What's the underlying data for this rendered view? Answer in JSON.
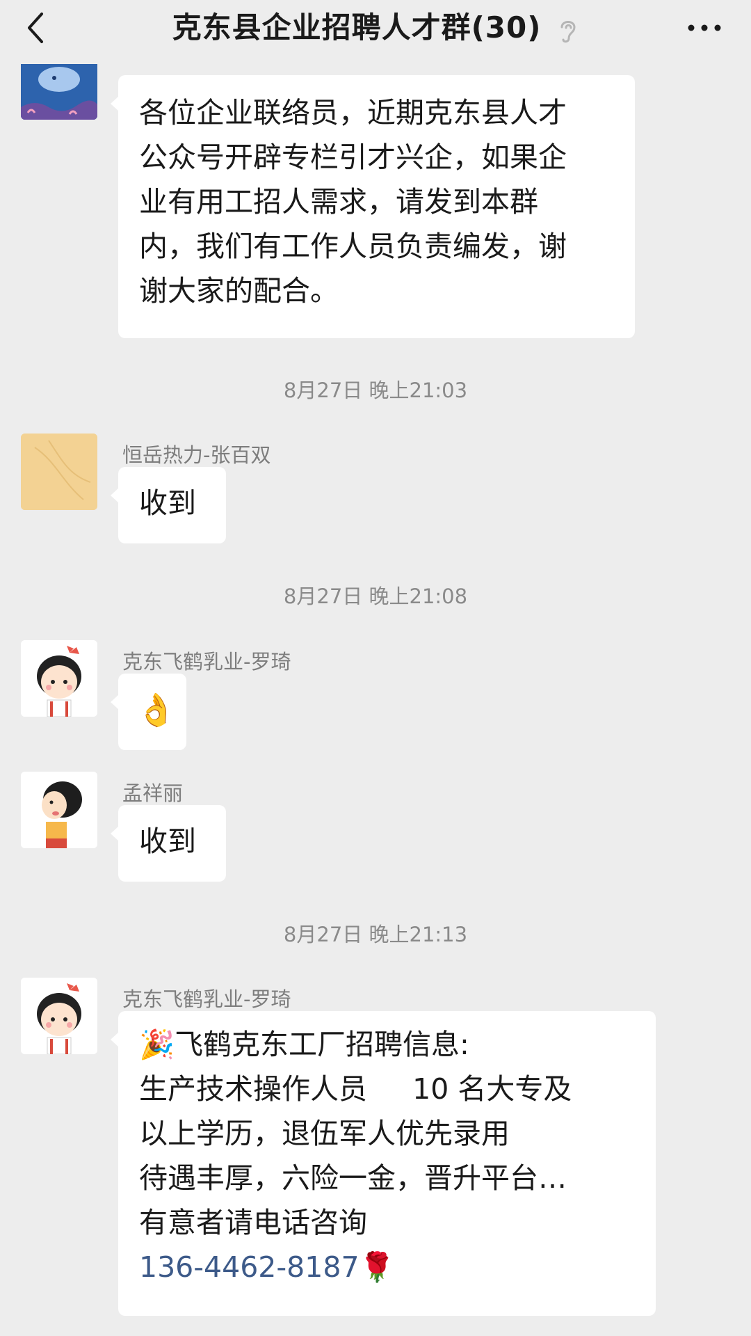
{
  "header": {
    "title": "克东县企业招聘人才群(30)",
    "back_icon": "chevron-left-icon",
    "ear_icon": "ear-icon",
    "more_icon": "more-dots-icon"
  },
  "messages": [
    {
      "sender": "",
      "lines": [
        "各位企业联络员，近期克东县人才",
        "公众号开辟专栏引才兴企，如果企",
        "业有用工招人需求，请发到本群",
        "内，我们有工作人员负责编发，谢",
        "谢大家的配合。"
      ]
    },
    {
      "sender": "恒岳热力-张百双",
      "text": "收到"
    },
    {
      "sender": "克东飞鹤乳业-罗琦",
      "emoji": "👌"
    },
    {
      "sender": "孟祥丽",
      "text": "收到"
    },
    {
      "sender": "克东飞鹤乳业-罗琦",
      "lines": [
        "飞鹤克东工厂招聘信息:",
        "生产技术操作人员     10 名大专及",
        "以上学历，退伍军人优先录用",
        "待遇丰厚，六险一金，晋升平台…",
        "有意者请电话咨询"
      ],
      "lead_emoji": "🎉",
      "phone": "136-4462-8187",
      "trail_emoji": "🌹"
    }
  ],
  "timestamps": [
    "8月27日 晚上21:03",
    "8月27日 晚上21:08",
    "8月27日 晚上21:13"
  ],
  "colors": {
    "background": "#ededed",
    "bubble": "#ffffff",
    "link": "#3d5a89",
    "meta_text": "#8a8a8a"
  }
}
